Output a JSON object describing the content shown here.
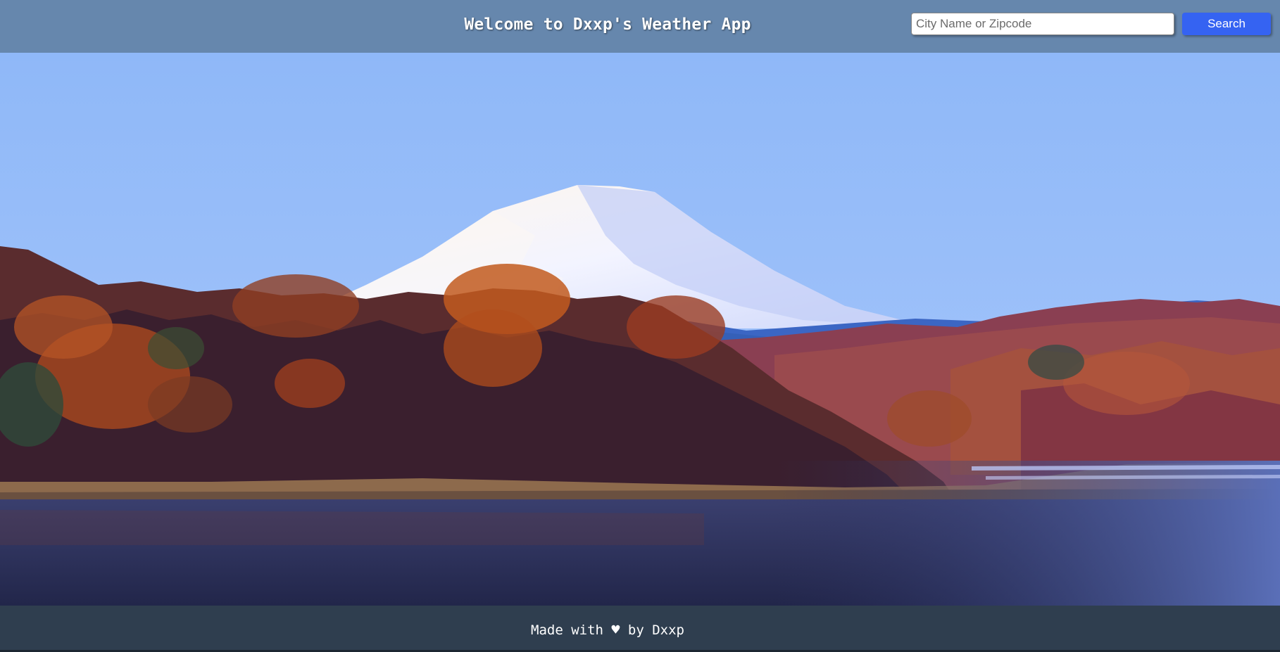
{
  "header": {
    "title": "Welcome to Dxxp's Weather App"
  },
  "search": {
    "placeholder": "City Name or Zipcode",
    "value": "",
    "button_label": "Search"
  },
  "footer": {
    "text_before": "Made with",
    "heart_icon": "heart-icon",
    "text_after": "by Dxxp"
  },
  "colors": {
    "header_bg": "#6687ad",
    "button_bg": "#3563f2",
    "footer_bg": "#2f3e4f"
  }
}
